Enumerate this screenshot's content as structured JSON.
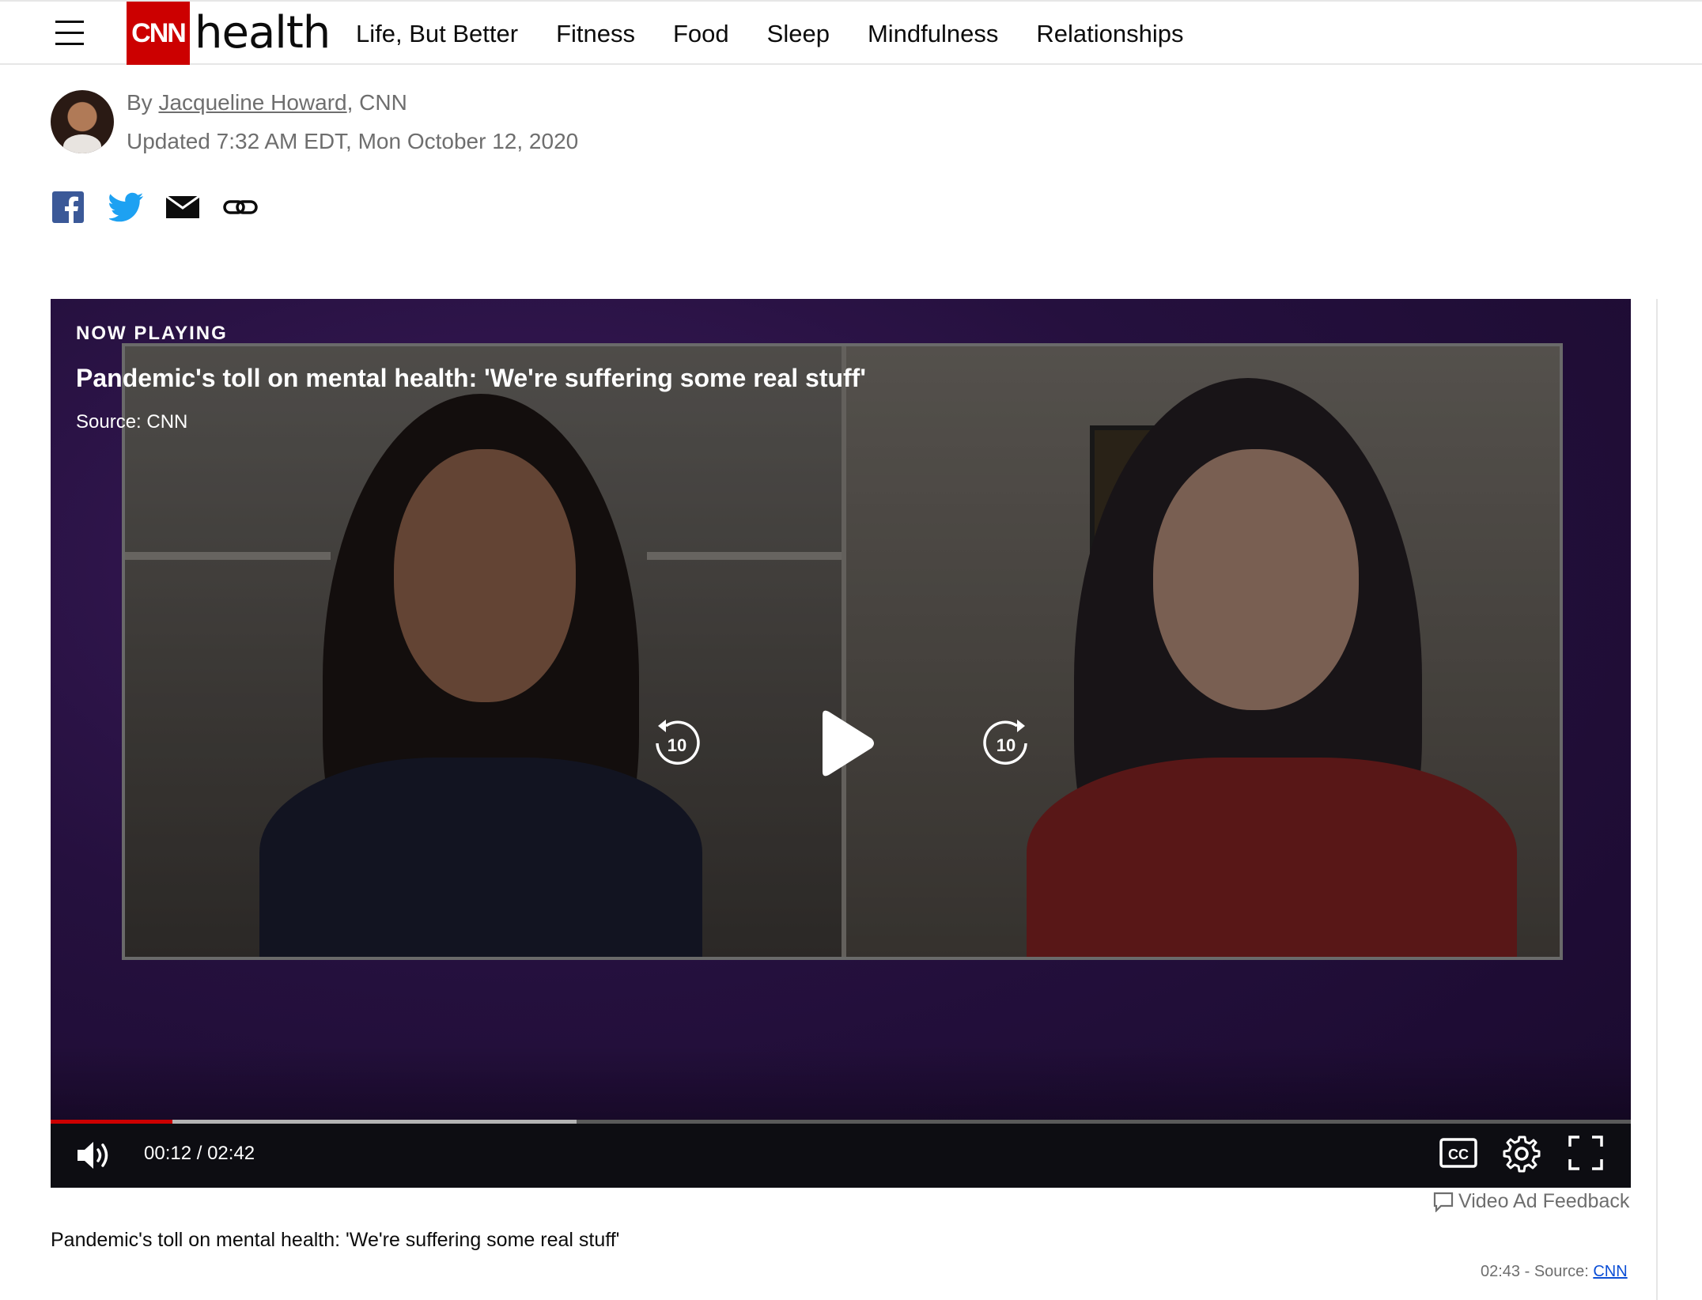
{
  "header": {
    "logo_text": "CNN",
    "section": "health",
    "nav": [
      "Life, But Better",
      "Fitness",
      "Food",
      "Sleep",
      "Mindfulness",
      "Relationships"
    ]
  },
  "byline": {
    "prefix": "By",
    "author": "Jacqueline Howard",
    "suffix": ", CNN",
    "updated": "Updated 7:32 AM EDT, Mon October 12, 2020"
  },
  "share": {
    "icons": [
      "facebook-icon",
      "twitter-icon",
      "email-icon",
      "link-icon"
    ],
    "colors": {
      "facebook": "#3b5998",
      "twitter": "#1da1f2",
      "dark": "#0c0c0c"
    }
  },
  "player": {
    "now_playing": "NOW PLAYING",
    "title": "Pandemic's toll on mental health: 'We're suffering some real stuff'",
    "source": "Source: CNN",
    "rewind_label": "10",
    "forward_label": "10",
    "current_time": "00:12",
    "duration": "02:42",
    "progress_played_fraction": 0.077,
    "progress_buffered_fraction": 0.333,
    "cc_label": "CC",
    "accent_color": "#cc0000"
  },
  "below_player": {
    "ad_feedback": "Video Ad Feedback",
    "caption": "Pandemic's toll on mental health: 'We're suffering some real stuff'",
    "duration": "02:43",
    "source_prefix": " - Source: ",
    "source_link": "CNN"
  }
}
